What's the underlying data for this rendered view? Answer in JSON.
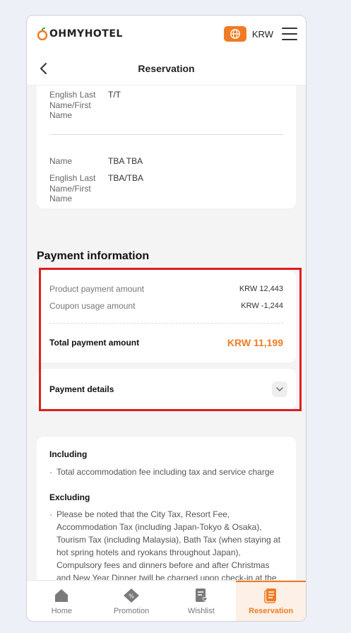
{
  "topbar": {
    "logo_text": "OHMYHOTEL",
    "currency": "KRW",
    "colors": {
      "brand": "#f07b26"
    }
  },
  "header": {
    "title": "Reservation"
  },
  "guest_card": {
    "rows": [
      {
        "label": "English Last Name/First Name",
        "value": "T/T"
      },
      {
        "label": "Name",
        "value": "TBA TBA"
      },
      {
        "label": "English Last Name/First Name",
        "value": "TBA/TBA"
      }
    ]
  },
  "payment": {
    "section_title": "Payment information",
    "product_label": "Product payment amount",
    "product_amount": "KRW 12,443",
    "coupon_label": "Coupon usage amount",
    "coupon_amount": "KRW -1,244",
    "total_label": "Total payment amount",
    "total_amount": "KRW 11,199",
    "details_label": "Payment details"
  },
  "policy": {
    "including_title": "Including",
    "including_text": "Total accommodation fee including tax and service charge",
    "excluding_title": "Excluding",
    "excluding_text": "Please be noted that the City Tax, Resort Fee, Accommodation Tax (including Japan-Tokyo & Osaka), Tourism Tax (including Malaysia), Bath Tax (when staying at hot spring hotels and ryokans throughout Japan), Compulsory fees and dinners before and after Christmas and New Year Dinner twill be charged upon check-in at the hotel according to the Policy of each country or each hotel."
  },
  "bottom_nav": {
    "items": [
      {
        "label": "Home",
        "icon": "home-icon"
      },
      {
        "label": "Promotion",
        "icon": "promotion-icon"
      },
      {
        "label": "Wishlist",
        "icon": "wishlist-icon"
      },
      {
        "label": "Reservation",
        "icon": "reservation-icon"
      }
    ],
    "active": "Reservation"
  }
}
